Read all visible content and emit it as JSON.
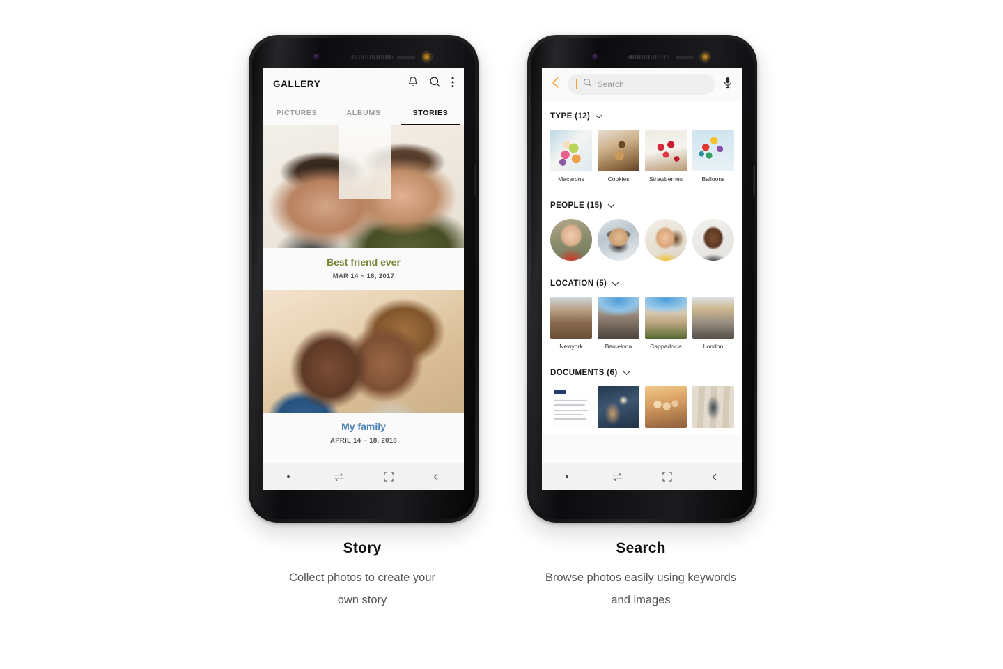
{
  "phones": {
    "story": {
      "app": {
        "title": "GALLERY",
        "icons": [
          "bell-icon",
          "search-icon",
          "more-vertical-icon"
        ],
        "tabs": [
          {
            "label": "PICTURES",
            "active": false
          },
          {
            "label": "ALBUMS",
            "active": false
          },
          {
            "label": "STORIES",
            "active": true
          }
        ]
      },
      "stories": [
        {
          "name": "Best friend ever",
          "date": "MAR 14 ~ 18, 2017",
          "color": "#7a8238",
          "photo": "two-men-smiling"
        },
        {
          "name": "My family",
          "date": "APRIL 14 ~ 18, 2018",
          "color": "#4a82b8",
          "photo": "couple-selfie"
        }
      ],
      "navbar": [
        "dot-icon",
        "recents-icon",
        "home-icon",
        "back-icon"
      ]
    },
    "search": {
      "header": {
        "back": "back-chevron-icon",
        "placeholder": "Search",
        "value": "",
        "mic": "microphone-icon",
        "accent": "#f0a030"
      },
      "sections": [
        {
          "title": "TYPE (12)",
          "kind": "thumb",
          "items": [
            {
              "label": "Macarons",
              "art": "t-macarons"
            },
            {
              "label": "Cookies",
              "art": "t-cookies"
            },
            {
              "label": "Strawberries",
              "art": "t-straw"
            },
            {
              "label": "Balloons",
              "art": "t-balloons"
            }
          ]
        },
        {
          "title": "PEOPLE (15)",
          "kind": "avatar",
          "items": [
            {
              "label": "",
              "art": "av1"
            },
            {
              "label": "",
              "art": "av2"
            },
            {
              "label": "",
              "art": "av3"
            },
            {
              "label": "",
              "art": "av4"
            }
          ]
        },
        {
          "title": "LOCATION (5)",
          "kind": "thumb",
          "items": [
            {
              "label": "Newyork",
              "art": "t-ny"
            },
            {
              "label": "Barcelona",
              "art": "t-bcn"
            },
            {
              "label": "Cappadocia",
              "art": "t-capp"
            },
            {
              "label": "London",
              "art": "t-london"
            }
          ]
        },
        {
          "title": "DOCUMENTS (6)",
          "kind": "thumb-cut",
          "items": [
            {
              "label": "",
              "art": "t-doc"
            },
            {
              "label": "",
              "art": "t-d2"
            },
            {
              "label": "",
              "art": "t-d3"
            },
            {
              "label": "",
              "art": "t-d4"
            }
          ]
        }
      ],
      "navbar": [
        "dot-icon",
        "recents-icon",
        "home-icon",
        "back-icon"
      ]
    }
  },
  "captions": [
    {
      "title": "Story",
      "line1": "Collect photos to create your",
      "line2": "own story"
    },
    {
      "title": "Search",
      "line1": "Browse photos easily using keywords",
      "line2": "and images"
    }
  ]
}
